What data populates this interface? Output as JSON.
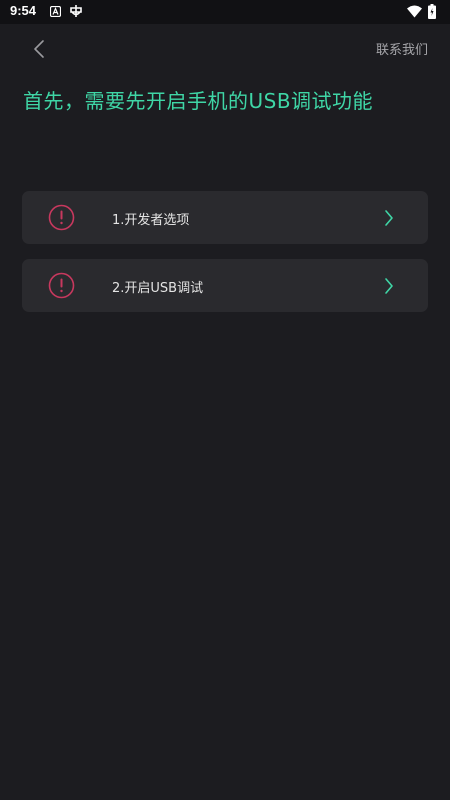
{
  "status_bar": {
    "time": "9:54",
    "icons": [
      "a-notification-icon",
      "bug-icon",
      "wifi-icon",
      "battery-icon"
    ]
  },
  "app_bar": {
    "back_icon": "chevron-left-icon",
    "contact_label": "联系我们"
  },
  "page": {
    "title": "首先，需要先开启手机的USB调试功能"
  },
  "steps": [
    {
      "label": "1.开发者选项",
      "icon": "warning-circle-icon",
      "arrow": "chevron-right-icon"
    },
    {
      "label": "2.开启USB调试",
      "icon": "warning-circle-icon",
      "arrow": "chevron-right-icon"
    }
  ],
  "colors": {
    "background": "#1c1c20",
    "card": "#2a2a2e",
    "accent": "#3fd6a6",
    "warning": "#c8385e",
    "muted_text": "#a6a6aa"
  }
}
